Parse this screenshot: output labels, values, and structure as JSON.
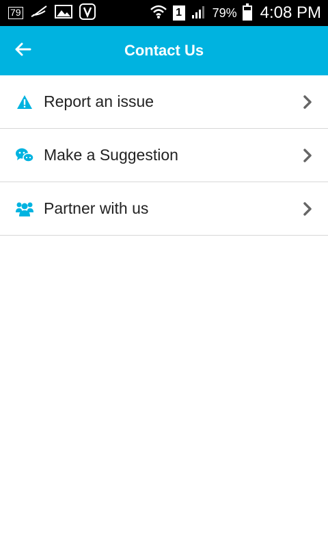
{
  "status_bar": {
    "left_badge": "79",
    "sim": "1",
    "battery": "79%",
    "time": "4:08 PM",
    "icons": [
      "notification-badge-icon",
      "feather-icon",
      "image-icon",
      "music-app-icon",
      "wifi-icon",
      "sim-icon",
      "signal-icon",
      "battery-icon"
    ]
  },
  "toolbar": {
    "title": "Contact Us",
    "back_icon": "arrow-left-icon"
  },
  "menu": {
    "items": [
      {
        "label": "Report an issue",
        "icon": "warning-icon"
      },
      {
        "label": "Make a Suggestion",
        "icon": "chat-bubbles-icon"
      },
      {
        "label": "Partner with us",
        "icon": "users-icon"
      }
    ],
    "chevron_icon": "chevron-right-icon"
  },
  "colors": {
    "accent": "#00b3e0",
    "divider": "#d7d7d7",
    "text": "#222222",
    "chevron": "#666666"
  }
}
